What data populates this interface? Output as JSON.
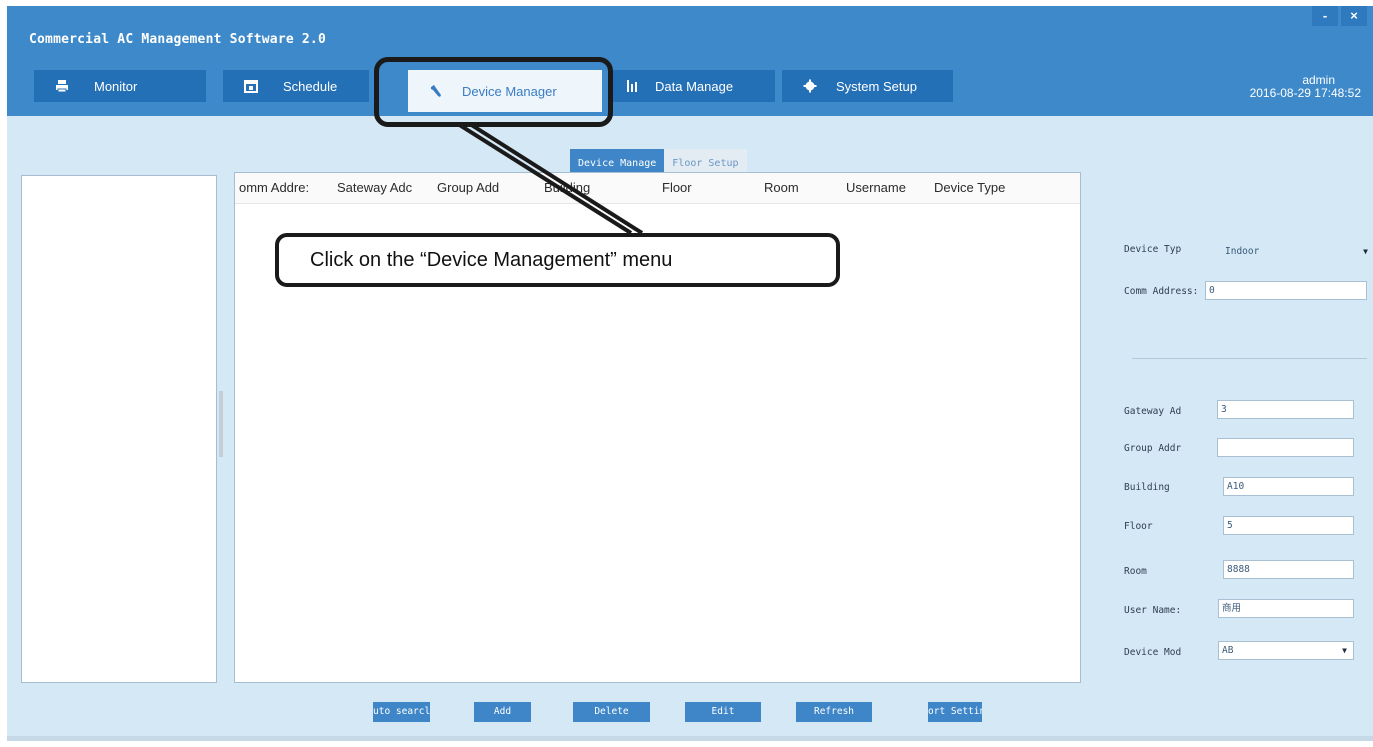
{
  "window": {
    "title": "Commercial AC Management Software 2.0",
    "controls": {
      "minimize": "-",
      "close": "×"
    }
  },
  "tabs": [
    {
      "label": "Monitor",
      "icon": "printer-icon"
    },
    {
      "label": "Schedule",
      "icon": "calendar-icon"
    },
    {
      "label": "Device Manager",
      "icon": "wrench-icon",
      "active": true
    },
    {
      "label": "Data Manage",
      "icon": "bar-chart-icon"
    },
    {
      "label": "System Setup",
      "icon": "gear-icon"
    }
  ],
  "user": {
    "name": "admin",
    "datetime": "2016-08-29 17:48:52"
  },
  "subtabs": [
    {
      "label": "Device Manage",
      "active": true
    },
    {
      "label": "Floor Setup",
      "active": false
    }
  ],
  "grid": {
    "columns": [
      "omm Addre:",
      "Sateway Adc",
      "Group Add",
      "Building",
      "Floor",
      "Room",
      "Username",
      "Device Type"
    ]
  },
  "details": {
    "device_type": {
      "label": "Device Typ",
      "value": "Indoor"
    },
    "comm_address": {
      "label": "Comm Address:",
      "value": "0"
    },
    "gateway": {
      "label": "Gateway Ad",
      "value": "3"
    },
    "group": {
      "label": "Group Addr",
      "value": ""
    },
    "building": {
      "label": "Building",
      "value": "A10"
    },
    "floor": {
      "label": "Floor",
      "value": "5"
    },
    "room": {
      "label": "Room",
      "value": "8888"
    },
    "user_name": {
      "label": "User Name:",
      "value": "商用"
    },
    "device_model": {
      "label": "Device Mod",
      "value": "AB"
    }
  },
  "buttons": {
    "auto_search": "uto searcl",
    "add": "Add",
    "delete": "Delete",
    "edit": "Edit",
    "refresh": "Refresh",
    "port_setting": "ort Settin"
  },
  "callout": {
    "text": "Click on the “Device Management” menu"
  },
  "colors": {
    "titlebar": "#3d89c9",
    "tab": "#2470b6",
    "content_bg": "#d5e8f5",
    "button": "#3e86c8"
  }
}
